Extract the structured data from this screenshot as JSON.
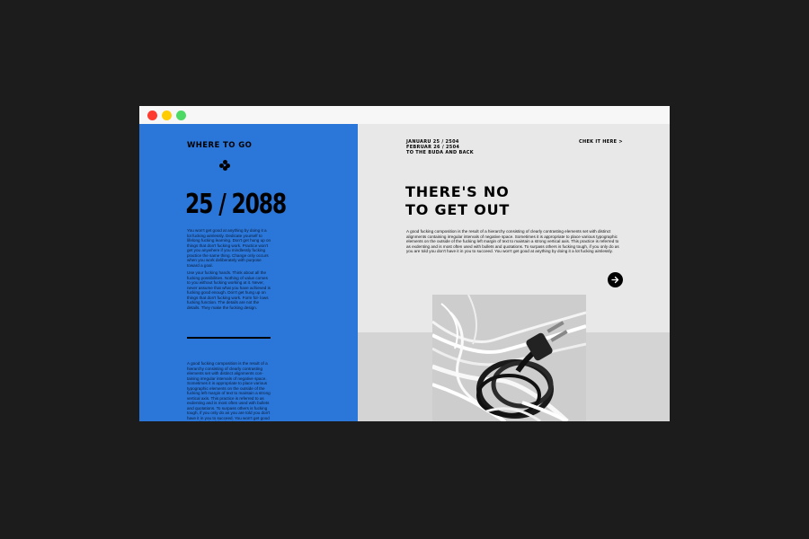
{
  "left": {
    "title": "WHERE TO GO",
    "big_number": "25 / 2088",
    "paragraphs": [
      "You won't get good at anything by doing it a lot fucking aimlessly. Dedicate yourself to lifelong fucking learning. Don't get hung up on things that don't fucking work. Practice won't get you anywhere if you mindlessly fucking practice the same thing. Change only occurs when you work deliberately with purpose toward a goal.",
      "Use your fucking hands. Think about all the fucking possibilities. Nothing of value comes to you without fucking working at it. Never, never assume that what you have achieved is fucking good enough. Don't get hung up on things that don't fucking work. Form fol- lows fucking function. The details are not the details. They make the fucking design.",
      "A good fucking composition is the result of a hierarchy consisting of clearly contrasting elements set with distinct alignments con- taining irregular intervals of negative space. Sometimes it is appropriate to place various typographic elements on the outside of the fucking left margin of text to maintain a strong vertical axis. This practice is referred to as exdenting and is most often used with bullets and quotations. To surpass others is fucking tough, if you only do as you are told you don't have it in you to succeed. You won't get good at anything by doing it a lot"
    ]
  },
  "right": {
    "dates": [
      "JANUARU 25 / 2504",
      "FEBRUAR  26 / 2504",
      "TO THE BUDA AND BACK"
    ],
    "link": "CHEK IT HERE >",
    "headline": [
      "THERE'S NO",
      "TO GET OUT"
    ],
    "body": "A good fucking composition is the result of a hierarchy consisting of clearly contrasting elements set with distinct alignments containing irregular intervals of negative space. Sometimes it is appropriate to place various typographic elements on the outside of the fucking left margin of text to maintain a strong vertical axis. This practice is referred to as exdenting and is most often used with bullets and quotations. To surpass others is fucking tough, if you only do as you are told you don't have it in you to succeed. You won't get good at anything by doing it a lot fucking aimlessly."
  },
  "colors": {
    "accent": "#2b76d9",
    "backdrop": "#1c1c1c",
    "panel": "#e8e8e8"
  },
  "icons": [
    "window-close-dot",
    "window-minimize-dot",
    "window-zoom-dot",
    "clover-icon",
    "arrow-right-icon"
  ]
}
